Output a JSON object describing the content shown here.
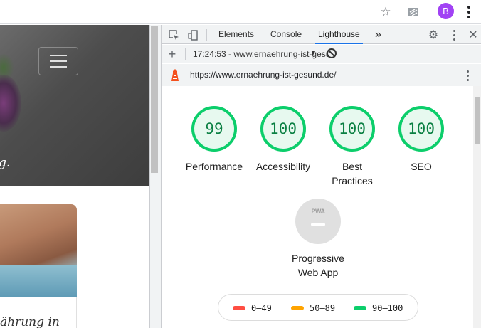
{
  "browser": {
    "avatar_initial": "B",
    "icons": [
      "star-icon",
      "extensions-icon",
      "kebab-menu-icon"
    ]
  },
  "webpage": {
    "hero_text": "g.",
    "card_text": "ährung in"
  },
  "devtools": {
    "tabs": [
      {
        "label": "Elements"
      },
      {
        "label": "Console"
      },
      {
        "label": "Lighthouse"
      }
    ],
    "more_tabs_label": "»",
    "run_label": "17:24:53 - www.ernaehrung-ist-gesund.de",
    "url": "https://www.ernaehrung-ist-gesund.de/",
    "accent_color": "#1a73e8"
  },
  "report": {
    "categories": [
      {
        "label": "Performance",
        "score": "99"
      },
      {
        "label": "Accessibility",
        "score": "100"
      },
      {
        "label": "Best Practices",
        "score": "100"
      },
      {
        "label": "SEO",
        "score": "100"
      }
    ],
    "pwa": {
      "badge_text": "PWA",
      "label": "Progressive Web App"
    },
    "legend": [
      {
        "range": "0–49",
        "color": "#ff4e42"
      },
      {
        "range": "50–89",
        "color": "#ffa400"
      },
      {
        "range": "90–100",
        "color": "#0cce6b"
      }
    ],
    "pass_color": "#0cce6b"
  }
}
